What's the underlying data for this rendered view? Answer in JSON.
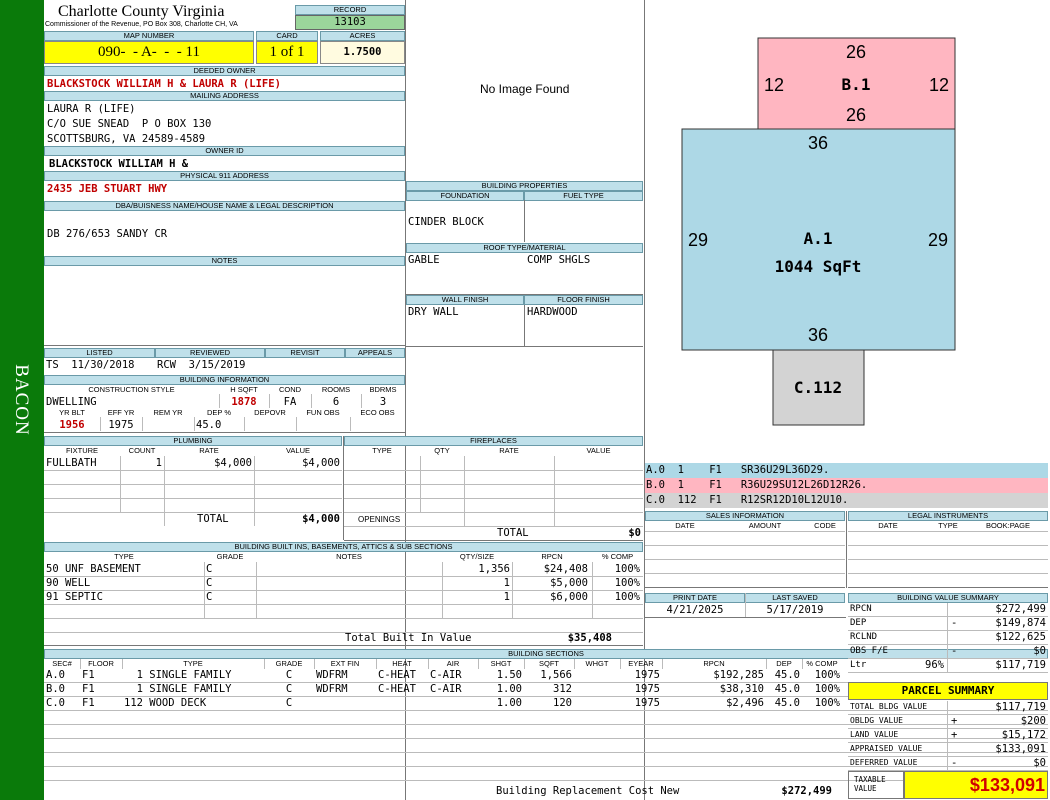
{
  "sidebar": {
    "label": "BACON"
  },
  "header": {
    "county": "Charlotte County Virginia",
    "commissioner": "Commissioner of the Revenue, PO Box 308, Charlotte CH, VA",
    "record_label": "RECORD",
    "record": "13103"
  },
  "parcel": {
    "map_label": "MAP NUMBER",
    "map_number": "090-  - A-  -  - 11",
    "card_label": "CARD",
    "card": "1 of 1",
    "acres_label": "ACRES",
    "acres": "1.7500"
  },
  "owner": {
    "deeded_label": "DEEDED OWNER",
    "deeded": "BLACKSTOCK WILLIAM H & LAURA R (LIFE)",
    "mailing_label": "MAILING ADDRESS",
    "mail_line1": "LAURA R (LIFE)",
    "mail_line2": "C/O SUE SNEAD  P O BOX 130",
    "mail_line3": "SCOTTSBURG, VA 24589-4589",
    "owner_id_label": "OWNER ID",
    "owner_id": "BLACKSTOCK WILLIAM H &",
    "physical_label": "PHYSICAL 911 ADDRESS",
    "physical": "2435 JEB STUART HWY"
  },
  "legal": {
    "label": "DBA/BUISNESS NAME/HOUSE NAME & LEGAL DESCRIPTION",
    "text": "DB 276/653 SANDY CR"
  },
  "notes": {
    "label": "NOTES",
    "text": ""
  },
  "image": {
    "text": "No Image Found"
  },
  "building_props": {
    "label": "BUILDING PROPERTIES",
    "foundation_label": "FOUNDATION",
    "foundation": "CINDER BLOCK",
    "fuel_label": "FUEL TYPE",
    "fuel": "",
    "roof_label": "ROOF TYPE/MATERIAL",
    "roof_type": "GABLE",
    "roof_material": "COMP SHGLS",
    "wall_label": "WALL FINISH",
    "wall": "DRY WALL",
    "floor_label": "FLOOR FINISH",
    "floor": "HARDWOOD"
  },
  "review": {
    "listed_label": "LISTED",
    "listed": "TS  11/30/2018",
    "reviewed_label": "REVIEWED",
    "reviewed": "RCW  3/15/2019",
    "revisit_label": "REVISIT",
    "revisit": "",
    "appeals_label": "APPEALS",
    "appeals": ""
  },
  "building_info": {
    "label": "BUILDING INFORMATION",
    "style_label": "CONSTRUCTION STYLE",
    "style": "DWELLING",
    "hsqft_label": "H SQFT",
    "hsqft": "1878",
    "cond_label": "COND",
    "cond": "FA",
    "rooms_label": "ROOMS",
    "rooms": "6",
    "bdrms_label": "BDRMS",
    "bdrms": "3",
    "yrblt_label": "YR BLT",
    "yrblt": "1956",
    "effyr_label": "EFF YR",
    "effyr": "1975",
    "remyr_label": "REM YR",
    "remyr": "",
    "dep_label": "DEP %",
    "dep": "45.0",
    "depovr_label": "DEPOVR",
    "depovr": "",
    "funobs_label": "FUN OBS",
    "funobs": "",
    "ecoobs_label": "ECO OBS",
    "ecoobs": ""
  },
  "plumbing": {
    "label": "PLUMBING",
    "headers": [
      "FIXTURE",
      "COUNT",
      "RATE",
      "VALUE"
    ],
    "rows": [
      {
        "fixture": "FULLBATH",
        "count": "1",
        "rate": "$4,000",
        "value": "$4,000"
      }
    ],
    "total_label": "TOTAL",
    "total": "$4,000"
  },
  "fireplaces": {
    "label": "FIREPLACES",
    "headers": [
      "TYPE",
      "QTY",
      "RATE",
      "VALUE"
    ],
    "openings_label": "OPENINGS",
    "total_label": "TOTAL",
    "total": "$0"
  },
  "builtins": {
    "label": "BUILDING BUILT INS, BASEMENTS, ATTICS & SUB SECTIONS",
    "headers": [
      "TYPE",
      "GRADE",
      "NOTES",
      "QTY/SIZE",
      "RPCN",
      "% COMP"
    ],
    "rows": [
      {
        "type": "50 UNF BASEMENT",
        "grade": "C",
        "notes": "",
        "qty": "1,356",
        "rpcn": "$24,408",
        "comp": "100%"
      },
      {
        "type": "90 WELL",
        "grade": "C",
        "notes": "",
        "qty": "1",
        "rpcn": "$5,000",
        "comp": "100%"
      },
      {
        "type": "91 SEPTIC",
        "grade": "C",
        "notes": "",
        "qty": "1",
        "rpcn": "$6,000",
        "comp": "100%"
      }
    ],
    "total_label": "Total Built In Value",
    "total": "$35,408"
  },
  "sections": {
    "label": "BUILDING SECTIONS",
    "headers": [
      "SEC#",
      "FLOOR",
      "TYPE",
      "GRADE",
      "EXT FIN",
      "HEAT",
      "AIR",
      "SHGT",
      "SQFT",
      "WHGT",
      "EYEAR",
      "RPCN",
      "DEP",
      "% COMP"
    ],
    "rows": [
      {
        "sec": "A.0",
        "floor": "F1",
        "type": "  1 SINGLE FAMILY",
        "grade": "C",
        "ext": "WDFRM",
        "heat": "C-HEAT",
        "air": "C-AIR",
        "shgt": "1.50",
        "sqft": "1,566",
        "whgt": "",
        "eyear": "1975",
        "rpcn": "$192,285",
        "dep": "45.0",
        "comp": "100%"
      },
      {
        "sec": "B.0",
        "floor": "F1",
        "type": "  1 SINGLE FAMILY",
        "grade": "C",
        "ext": "WDFRM",
        "heat": "C-HEAT",
        "air": "C-AIR",
        "shgt": "1.00",
        "sqft": "312",
        "whgt": "",
        "eyear": "1975",
        "rpcn": "$38,310",
        "dep": "45.0",
        "comp": "100%"
      },
      {
        "sec": "C.0",
        "floor": "F1",
        "type": "112 WOOD DECK",
        "grade": "C",
        "ext": "",
        "heat": "",
        "air": "",
        "shgt": "1.00",
        "sqft": "120",
        "whgt": "",
        "eyear": "1975",
        "rpcn": "$2,496",
        "dep": "45.0",
        "comp": "100%"
      }
    ],
    "total_label": "Building Replacement Cost New",
    "total": "$272,499"
  },
  "sketch": {
    "b": {
      "label": "B.1",
      "top": "26",
      "bottom": "26",
      "left": "12",
      "right": "12"
    },
    "a": {
      "label": "A.1",
      "area": "1044 SqFt",
      "top": "36",
      "bottom": "36",
      "left": "29",
      "right": "29"
    },
    "c": {
      "label": "C.112"
    },
    "colors": {
      "a": "#add8e6",
      "b": "#ffb6c1",
      "c": "#d3d3d3"
    }
  },
  "sketch_legend": [
    {
      "text": "A.0  1    F1   SR36U29L36D29."
    },
    {
      "text": "B.0  1    F1   R36U29SU12L26D12R26."
    },
    {
      "text": "C.0  112  F1   R12SR12D10L12U10."
    }
  ],
  "sales": {
    "label": "SALES INFORMATION",
    "headers": [
      "DATE",
      "AMOUNT",
      "CODE"
    ]
  },
  "legal_inst": {
    "label": "LEGAL INSTRUMENTS",
    "headers": [
      "DATE",
      "TYPE",
      "BOOK:PAGE"
    ]
  },
  "dates": {
    "print_label": "PRINT DATE",
    "print": "4/21/2025",
    "saved_label": "LAST SAVED",
    "saved": "5/17/2019"
  },
  "value_summary": {
    "label": "BUILDING VALUE SUMMARY",
    "rows": [
      {
        "label": "RPCN",
        "sign": "",
        "pct": "",
        "value": "$272,499"
      },
      {
        "label": "DEP",
        "sign": "-",
        "pct": "",
        "value": "$149,874"
      },
      {
        "label": "RCLND",
        "sign": "",
        "pct": "",
        "value": "$122,625"
      },
      {
        "label": "OBS F/E",
        "sign": "-",
        "pct": "",
        "value": "$0"
      },
      {
        "label": "Ltr",
        "sign": "",
        "pct": "96%",
        "value": "$117,719"
      }
    ]
  },
  "parcel_summary": {
    "label": "PARCEL SUMMARY",
    "rows": [
      {
        "label": "TOTAL BLDG VALUE",
        "sign": "",
        "value": "$117,719"
      },
      {
        "label": "OBLDG VALUE",
        "sign": "+",
        "value": "$200"
      },
      {
        "label": "LAND VALUE",
        "sign": "+",
        "value": "$15,172"
      },
      {
        "label": "APPRAISED VALUE",
        "sign": "",
        "value": "$133,091"
      },
      {
        "label": "DEFERRED VALUE",
        "sign": "-",
        "value": "$0"
      }
    ],
    "taxable_label": "TAXABLE VALUE",
    "taxable": "$133,091"
  }
}
